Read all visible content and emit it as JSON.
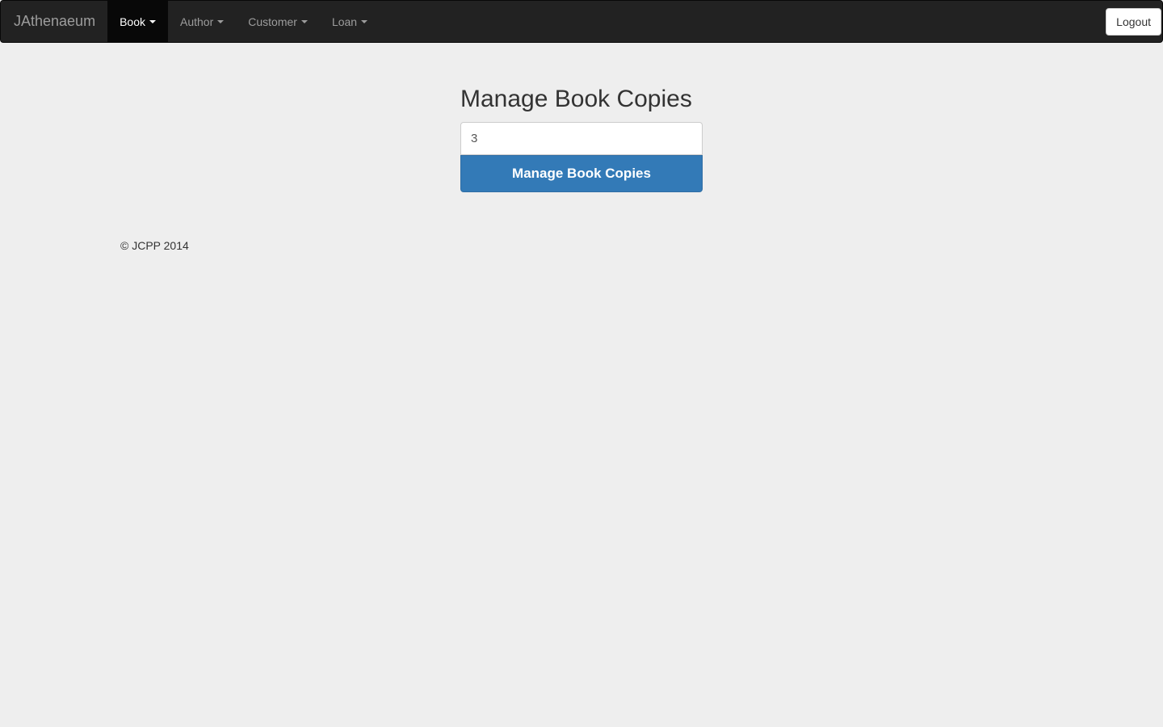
{
  "navbar": {
    "brand": "JAthenaeum",
    "items": [
      {
        "label": "Book",
        "active": true
      },
      {
        "label": "Author",
        "active": false
      },
      {
        "label": "Customer",
        "active": false
      },
      {
        "label": "Loan",
        "active": false
      }
    ],
    "logout_label": "Logout"
  },
  "form": {
    "title": "Manage Book Copies",
    "input_value": "3",
    "button_label": "Manage Book Copies"
  },
  "footer": {
    "text": "© JCPP 2014"
  },
  "colors": {
    "navbar_bg": "#222222",
    "page_bg": "#eeeeee",
    "primary": "#337ab7"
  }
}
